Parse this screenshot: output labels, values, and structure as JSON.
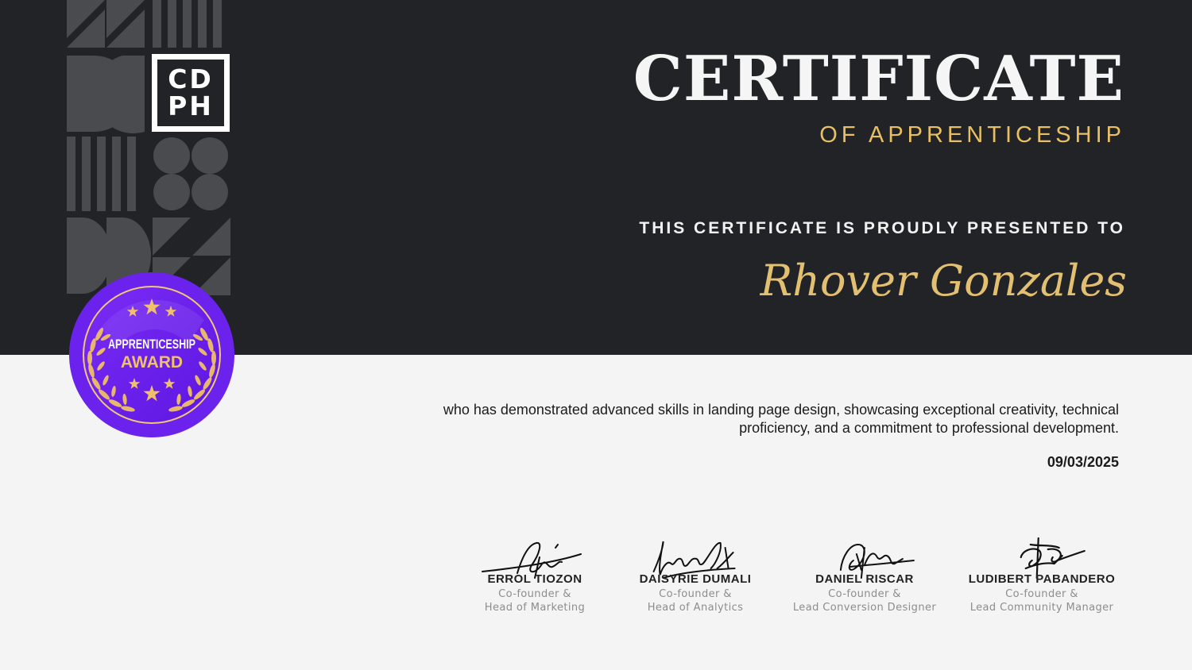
{
  "certificate": {
    "title": "CERTIFICATE",
    "subtitle": "OF APPRENTICESHIP",
    "presented_to": "THIS CERTIFICATE IS PROUDLY PRESENTED TO",
    "recipient": "Rhover Gonzales",
    "description": "who has demonstrated advanced skills in landing page design, showcasing exceptional creativity, technical proficiency, and a commitment to professional development.",
    "date": "09/03/2025"
  },
  "logo": {
    "line1": "CD",
    "line2": "PH"
  },
  "badge": {
    "line1": "APPRENTICESHIP",
    "line2": "AWARD",
    "icon": "laurel-wreath-stars-icon"
  },
  "signatories": [
    {
      "name": "ERROL TIOZON",
      "role_line1": "Co-founder &",
      "role_line2": "Head of Marketing"
    },
    {
      "name": "DAISYRIE DUMALI",
      "role_line1": "Co-founder &",
      "role_line2": "Head of Analytics"
    },
    {
      "name": "DANIEL RISCAR",
      "role_line1": "Co-founder &",
      "role_line2": "Lead Conversion Designer"
    },
    {
      "name": "LUDIBERT PABANDERO",
      "role_line1": "Co-founder &",
      "role_line2": "Lead Community Manager"
    }
  ],
  "colors": {
    "dark_band": "#212326",
    "light_background": "#f4f4f5",
    "gold_accent": "#e8c063",
    "badge_purple": "#6e1ff0",
    "pattern_gray": "#4a4b4e"
  }
}
